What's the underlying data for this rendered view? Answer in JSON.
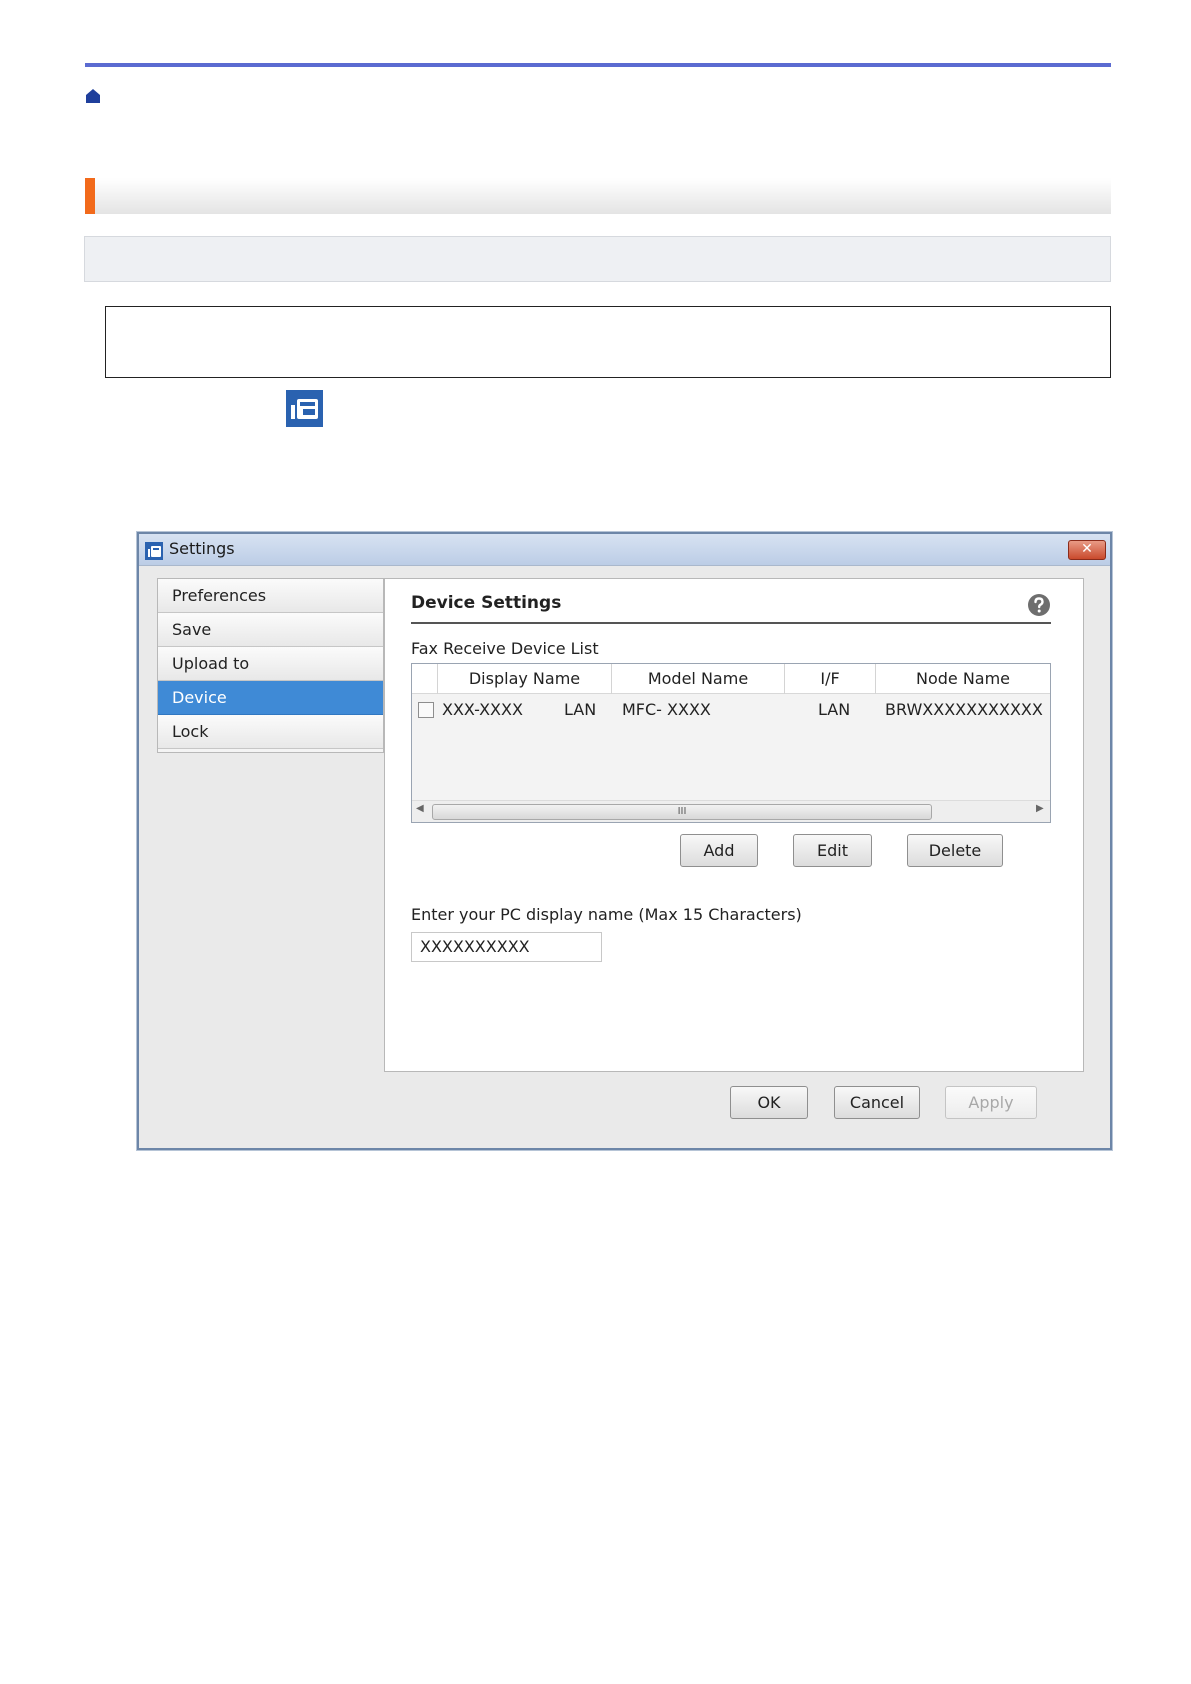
{
  "dialog": {
    "title": "Settings",
    "close_glyph": "✕",
    "sidebar": {
      "items": [
        {
          "label": "Preferences",
          "active": false
        },
        {
          "label": "Save",
          "active": false
        },
        {
          "label": "Upload to",
          "active": false
        },
        {
          "label": "Device",
          "active": true
        },
        {
          "label": "Lock",
          "active": false
        }
      ]
    },
    "panel": {
      "title": "Device Settings",
      "list_label": "Fax Receive Device List",
      "columns": [
        "Display Name",
        "Model Name",
        "I/F",
        "Node Name"
      ],
      "rows": [
        {
          "display_name": "XXX-XXXX",
          "display_if": "LAN",
          "model_name": "MFC- XXXX",
          "if": "LAN",
          "node_name": "BRWXXXXXXXXXXX"
        }
      ],
      "scroll_thumb_glyph": "III",
      "buttons": {
        "add": "Add",
        "edit": "Edit",
        "delete": "Delete"
      },
      "pc_name_label": "Enter your PC display name (Max 15 Characters)",
      "pc_name_value": "XXXXXXXXXX"
    },
    "footer": {
      "ok": "OK",
      "cancel": "Cancel",
      "apply": "Apply"
    }
  },
  "colors": {
    "top_rule": "#5b6bd1",
    "title_accent": "#f26a1b",
    "sidebar_active": "#3f8ad6",
    "icon_blue": "#2a62b0"
  },
  "icons": {
    "home": "home-icon",
    "inline": "fax-app-icon",
    "help": "help-icon"
  }
}
